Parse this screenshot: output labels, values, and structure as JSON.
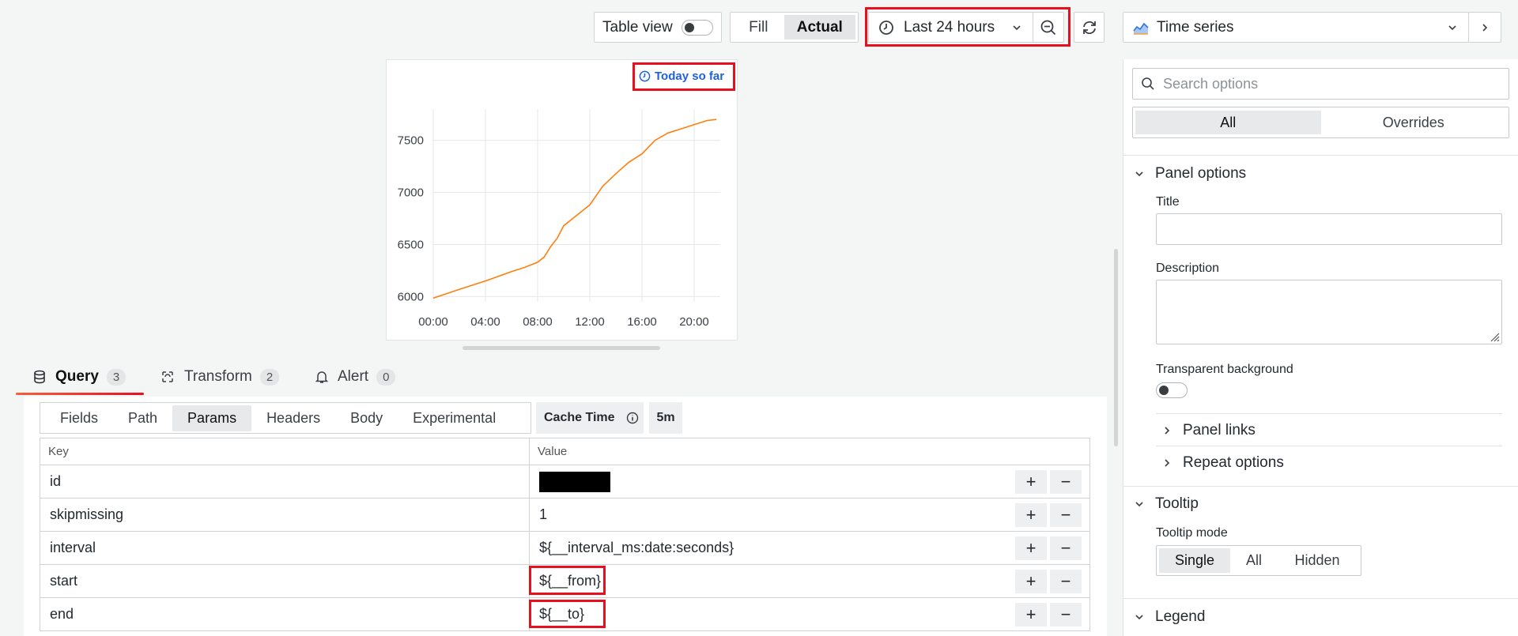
{
  "toolbar": {
    "table_view_label": "Table view",
    "fill_label": "Fill",
    "actual_label": "Actual",
    "time_range_label": "Last 24 hours"
  },
  "panel": {
    "badge_label": "Today so far"
  },
  "chart_data": {
    "type": "line",
    "x_tick_labels": [
      "00:00",
      "04:00",
      "08:00",
      "12:00",
      "16:00",
      "20:00"
    ],
    "y_tick_labels": [
      "6000",
      "6500",
      "7000",
      "7500"
    ],
    "ylim": [
      5950,
      7800
    ],
    "grid": true,
    "series": [
      {
        "color": "#ff7f0e",
        "points": [
          [
            0,
            5985
          ],
          [
            2,
            6070
          ],
          [
            4,
            6150
          ],
          [
            6,
            6240
          ],
          [
            7,
            6280
          ],
          [
            8,
            6330
          ],
          [
            8.5,
            6380
          ],
          [
            9,
            6480
          ],
          [
            9.5,
            6560
          ],
          [
            10,
            6680
          ],
          [
            11,
            6780
          ],
          [
            12,
            6880
          ],
          [
            13,
            7060
          ],
          [
            14,
            7180
          ],
          [
            15,
            7290
          ],
          [
            16,
            7370
          ],
          [
            17,
            7500
          ],
          [
            18,
            7570
          ],
          [
            19,
            7610
          ],
          [
            20,
            7650
          ],
          [
            21,
            7690
          ],
          [
            21.7,
            7700
          ]
        ]
      }
    ]
  },
  "query_tabs": [
    {
      "label": "Query",
      "count": "3"
    },
    {
      "label": "Transform",
      "count": "2"
    },
    {
      "label": "Alert",
      "count": "0"
    }
  ],
  "subtabs": [
    "Fields",
    "Path",
    "Params",
    "Headers",
    "Body",
    "Experimental"
  ],
  "cache": {
    "label": "Cache Time",
    "value": "5m"
  },
  "params_table": {
    "headers": [
      "Key",
      "Value"
    ],
    "rows": [
      {
        "key": "id",
        "value": ""
      },
      {
        "key": "skipmissing",
        "value": "1"
      },
      {
        "key": "interval",
        "value": "${__interval_ms:date:seconds}"
      },
      {
        "key": "start",
        "value": "${__from}"
      },
      {
        "key": "end",
        "value": "${__to}"
      }
    ]
  },
  "right_panel": {
    "visualization": "Time series",
    "search_placeholder": "Search options",
    "tab_all": "All",
    "tab_overrides": "Overrides",
    "panel_options": "Panel options",
    "title_label": "Title",
    "description_label": "Description",
    "transparent_label": "Transparent background",
    "panel_links": "Panel links",
    "repeat_options": "Repeat options",
    "tooltip": "Tooltip",
    "tooltip_mode": "Tooltip mode",
    "tooltip_modes": [
      "Single",
      "All",
      "Hidden"
    ],
    "legend": "Legend"
  }
}
